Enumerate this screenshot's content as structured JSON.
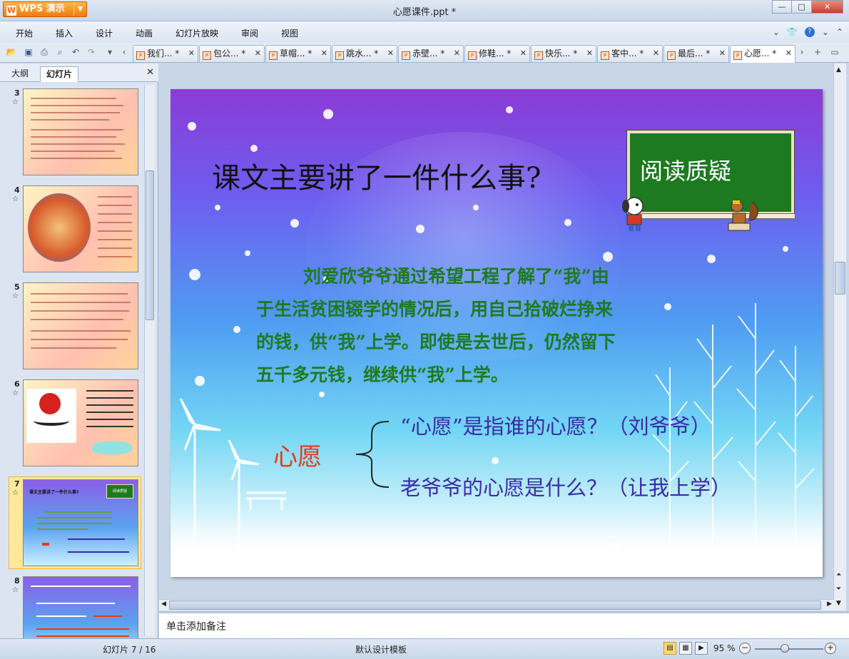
{
  "app": {
    "name": "WPS 演示",
    "logo": "W"
  },
  "window": {
    "title": "心愿课件.ppt *"
  },
  "menu": [
    "开始",
    "插入",
    "设计",
    "动画",
    "幻灯片放映",
    "审阅",
    "视图"
  ],
  "tabs": [
    "我们... *",
    "包公... *",
    "草帽... *",
    "跳水... *",
    "赤壁... *",
    "修鞋... *",
    "快乐... *",
    "客中... *",
    "最后... *",
    "心愿... *"
  ],
  "panel": {
    "outline_tab": "大纲",
    "slides_tab": "幻灯片"
  },
  "thumbnails": [
    {
      "num": "3"
    },
    {
      "num": "4"
    },
    {
      "num": "5"
    },
    {
      "num": "6"
    },
    {
      "num": "7",
      "title": "课文主要讲了一件什么事?",
      "board": "阅读质疑"
    },
    {
      "num": "8"
    }
  ],
  "slide": {
    "title": "课文主要讲了一件什么事?",
    "board": "阅读质疑",
    "paragraph": [
      "刘爱欣爷爷通过希望工程了解了“我”由",
      "于生活贫困辍学的情况后，用自己拾破烂挣来",
      "的钱，供“我”上学。即使是去世后，仍然留下",
      "五千多元钱，继续供“我”上学。"
    ],
    "keyword": "心愿",
    "question1": "“心愿”是指谁的心愿？（刘爷爷）",
    "question2": "老爷爷的心愿是什么？（让我上学）"
  },
  "notes": {
    "placeholder": "单击添加备注"
  },
  "status": {
    "slide": "幻灯片 7 / 16",
    "template": "默认设计模板",
    "zoom": "95 %"
  },
  "colors": {
    "accent": "#f07a10",
    "board": "#1d7a21",
    "paragraph": "#1f7a1f",
    "keyword": "#e53b14",
    "question": "#3b2aa8"
  }
}
